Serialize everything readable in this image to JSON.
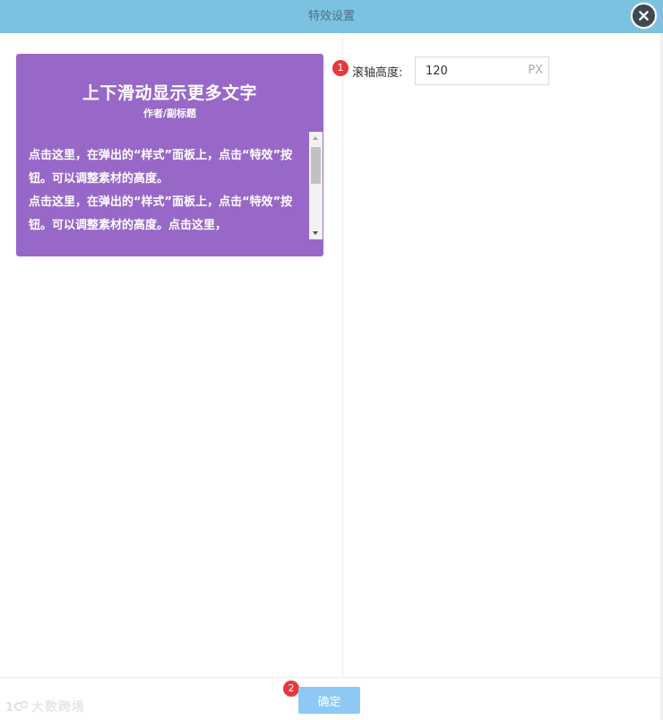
{
  "dialog": {
    "title": "特效设置",
    "close_icon": "close-icon"
  },
  "preview": {
    "background_color": "#9868c8",
    "title": "上下滑动显示更多文字",
    "subtitle": "作者/副标题",
    "paragraphs": [
      "点击这里，在弹出的“样式”面板上，点击“特效”按钮。可以调整素材的高度。",
      "点击这里，在弹出的“样式”面板上，点击“特效”按钮。可以调整素材的高度。点击这里，"
    ],
    "scroll_up_icon": "scroll-up-arrow-icon",
    "scroll_down_icon": "scroll-down-arrow-icon"
  },
  "settings": {
    "step_badge": "1",
    "scroll_height_label": "滚轴高度:",
    "scroll_height_value": "120",
    "scroll_height_unit": "PX"
  },
  "footer": {
    "step_badge": "2",
    "confirm_label": "确定",
    "confirm_color": "#8ec8f5",
    "watermark_text": "大数跨境"
  },
  "colors": {
    "titlebar": "#7bc2e1",
    "badge": "#e8383d"
  }
}
